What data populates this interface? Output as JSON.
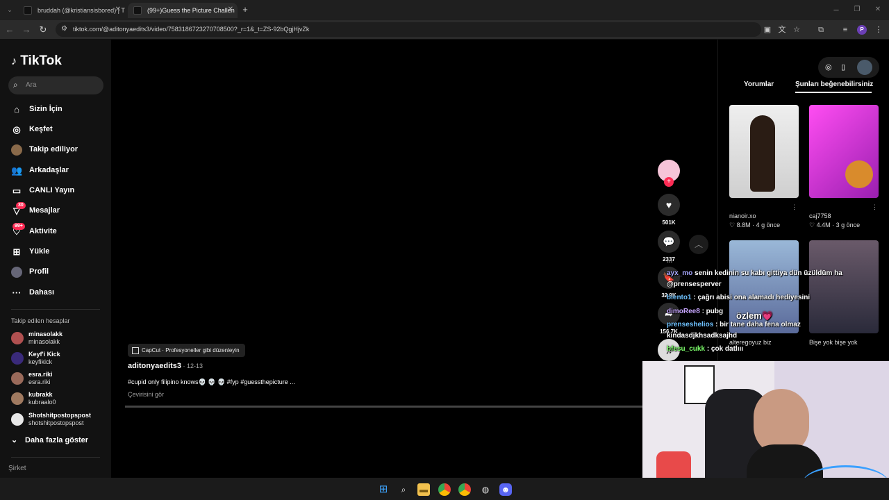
{
  "browser": {
    "tabs": [
      {
        "title": "bruddah (@kristiansisbored) | T",
        "active": false
      },
      {
        "title": "(99+)Guess the Picture Challen",
        "active": true
      }
    ],
    "url": "tiktok.com/@aditonyaedits3/video/7583186723270708500?_r=1&_t=ZS-92bQgjHjvZk",
    "profile_initial": "P"
  },
  "sidebar": {
    "logo": "TikTok",
    "search_placeholder": "Ara",
    "nav": [
      {
        "label": "Sizin İçin",
        "icon": "home-icon"
      },
      {
        "label": "Keşfet",
        "icon": "compass-icon"
      },
      {
        "label": "Takip ediliyor",
        "icon": "following-avatar-icon"
      },
      {
        "label": "Arkadaşlar",
        "icon": "friends-icon"
      },
      {
        "label": "CANLI Yayın",
        "icon": "live-icon"
      },
      {
        "label": "Mesajlar",
        "icon": "message-icon",
        "badge": "30"
      },
      {
        "label": "Aktivite",
        "icon": "activity-icon",
        "badge": "99+"
      },
      {
        "label": "Yükle",
        "icon": "upload-icon"
      },
      {
        "label": "Profil",
        "icon": "profile-icon"
      },
      {
        "label": "Dahası",
        "icon": "more-dots-icon"
      }
    ],
    "following_header": "Takip edilen hesaplar",
    "following": [
      {
        "name": "minasolakk",
        "username": "minasolakk",
        "color": "#b05050"
      },
      {
        "name": "Keyf'i Kick",
        "username": "keyfikick",
        "color": "#3a2a7a"
      },
      {
        "name": "esra.riki",
        "username": "esra.riki",
        "color": "#9a6a5a"
      },
      {
        "name": "kubrakk",
        "username": "kubraalo0",
        "color": "#a07a60"
      },
      {
        "name": "Shotshitpostopspost",
        "username": "shotshitpostopspost",
        "color": "#e8e8e8"
      }
    ],
    "show_more": "Daha fazla göster",
    "company": "Şirket"
  },
  "video": {
    "capcut_label": "CapCut · Profesyoneller gibi düzenleyin",
    "author": "aditonyaedits3",
    "date": " · 12-13",
    "description": "#cupid only filipino knows💀 💀 💀 #fyp #guessthepicture ...",
    "translate": "Çevirisini gör"
  },
  "actions": {
    "likes": "501K",
    "comments": "2337",
    "saves": "32.9K",
    "shares": "156.7K"
  },
  "right_panel": {
    "tabs": [
      "Yorumlar",
      "Şunları beğenebilirsiniz"
    ],
    "active_tab": 1,
    "videos": [
      {
        "user": "nianoir.xo",
        "stats": "♡ 8.8M · 4 g önce",
        "color": "#d8d8d8"
      },
      {
        "user": "caj7758",
        "stats": "♡ 4.4M · 3 g önce",
        "color": "#d43bd8"
      },
      {
        "user": "alteregoyuz biz",
        "stats": "",
        "color": "#8aa8c8"
      },
      {
        "user": "Bişe yok bişe yok",
        "stats": "",
        "color": "#5a4a5a"
      }
    ]
  },
  "chat": [
    {
      "user": "",
      "text": "..."
    },
    {
      "user": "ayx_mo",
      "text": "senin kedinin su kabı gittiya dün üzüldüm ha",
      "color": "#a7a7ff"
    },
    {
      "user": "",
      "text": "@prensesperver",
      "color": "#ffffff"
    },
    {
      "user": "biento1",
      "text": ": çağrı abisi ona alamadı hediyesini",
      "color": "#6ec2ff"
    },
    {
      "user": "",
      "text": "özlem💗",
      "color": "#ffffff"
    },
    {
      "user": "dimoRee8",
      "text": ": pubg",
      "color": "#c7a6ff"
    },
    {
      "user": "prenseshelios",
      "text": ": bir tane daha fena olmaz",
      "color": "#6ec2ff"
    },
    {
      "user": "",
      "text": "kindasdjkhsadksajhd",
      "color": "#ffffff"
    },
    {
      "user": "bfesu_cukk",
      "text": ": çok datlııı",
      "color": "#7dff6b"
    }
  ],
  "colors": {
    "accent": "#fe2c55",
    "sidebar_bg": "#121212",
    "browser_bg": "#1f1f1f"
  }
}
